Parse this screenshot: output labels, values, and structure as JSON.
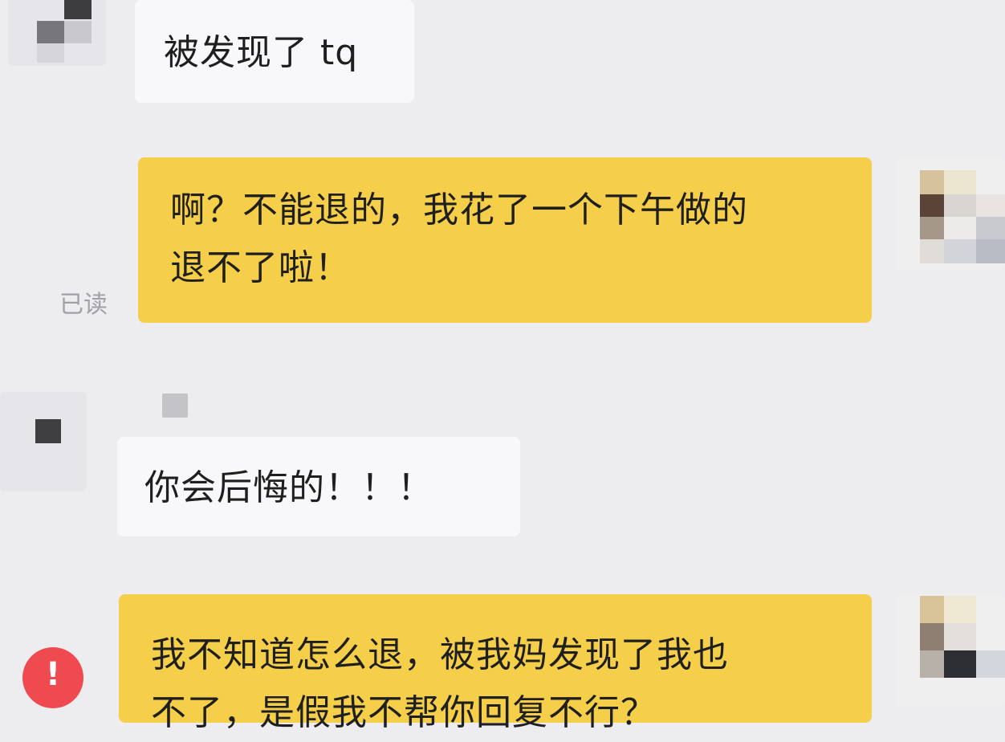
{
  "conversation": {
    "messages": [
      {
        "direction": "incoming",
        "lines": [
          "被发现了 tq"
        ]
      },
      {
        "direction": "outgoing",
        "lines": [
          "啊？不能退的，我花了一个下午做的",
          "退不了啦！"
        ],
        "status": "已读"
      },
      {
        "direction": "incoming",
        "lines": [
          "你会后悔的！！！"
        ]
      },
      {
        "direction": "outgoing",
        "lines": [
          "我不知道怎么退，被我妈发现了我也",
          "不了，是假我不帮你回复不行？"
        ],
        "status_icon": "!"
      }
    ]
  },
  "colors": {
    "background": "#ededf0",
    "incoming_bubble": "#f8f8fa",
    "outgoing_bubble": "#f6cf4a",
    "status_text": "#a0a0a8",
    "error_badge": "#ef4a4f"
  },
  "icons": {
    "contact_avatar": "pixelated-avatar-icon",
    "self_avatar": "pixelated-avatar-icon",
    "send_failed": "error-exclamation-icon"
  }
}
